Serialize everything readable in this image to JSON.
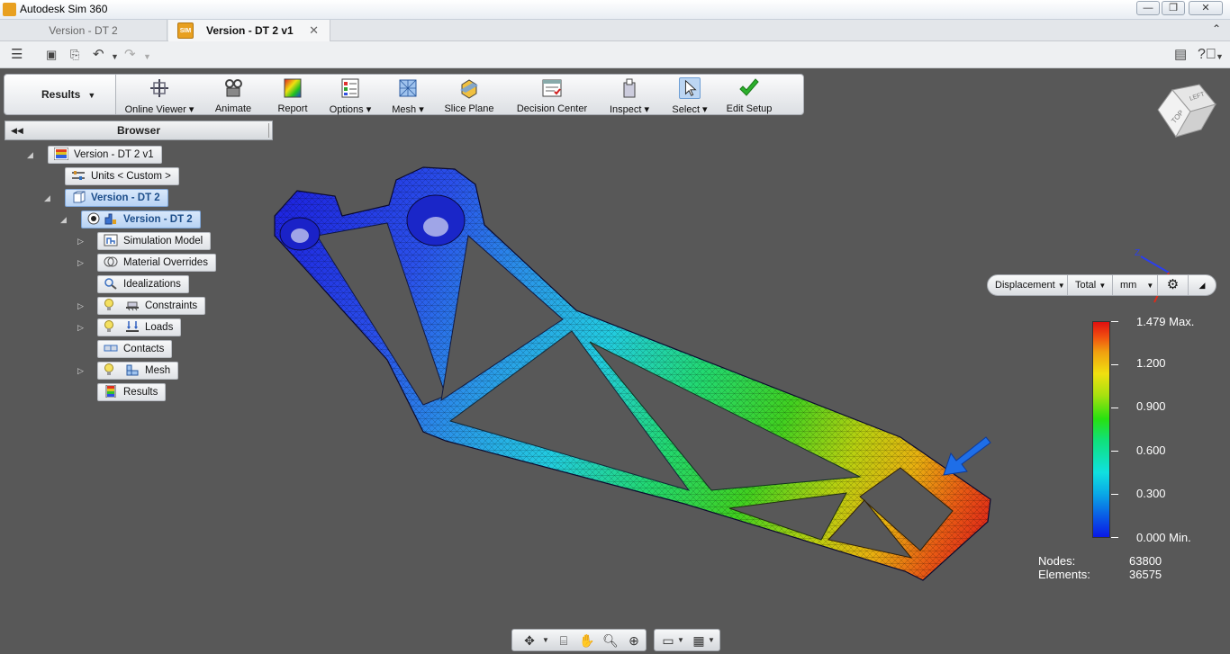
{
  "window": {
    "title": "Autodesk Sim 360",
    "min": "—",
    "max": "❐",
    "close": "✕"
  },
  "doc_tabs": {
    "inactive": "Version - DT 2",
    "active": "Version - DT 2 v1",
    "active_badge": "SIM",
    "close": "✕",
    "collapse": "⌃"
  },
  "ribbon": {
    "workspace": "Results",
    "buttons": [
      {
        "label": "Online Viewer",
        "caret": true
      },
      {
        "label": "Animate"
      },
      {
        "label": "Report"
      },
      {
        "label": "Options",
        "caret": true
      },
      {
        "label": "Mesh",
        "caret": true
      },
      {
        "label": "Slice Plane"
      },
      {
        "label": "Decision Center"
      },
      {
        "label": "Inspect",
        "caret": true
      },
      {
        "label": "Select",
        "caret": true
      },
      {
        "label": "Edit Setup"
      }
    ]
  },
  "browser": {
    "title": "Browser",
    "nodes": {
      "root": "Version - DT 2 v1",
      "units": "Units < Custom >",
      "study": "Version - DT 2",
      "scenario": "Version - DT 2",
      "simulation_model": "Simulation Model",
      "material_overrides": "Material Overrides",
      "idealizations": "Idealizations",
      "constraints": "Constraints",
      "loads": "Loads",
      "contacts": "Contacts",
      "mesh": "Mesh",
      "results": "Results"
    }
  },
  "legend": {
    "type": "Displacement",
    "component": "Total",
    "unit": "mm",
    "max_label": "1.479 Max.",
    "ticks": [
      "1.200",
      "0.900",
      "0.600",
      "0.300"
    ],
    "min_label": "0.000 Min."
  },
  "stats": {
    "nodes_label": "Nodes:",
    "nodes": "63800",
    "elements_label": "Elements:",
    "elements": "36575"
  },
  "viewcube": {
    "top": "TOP",
    "left": "LEFT"
  },
  "axis": {
    "z": "Z"
  }
}
